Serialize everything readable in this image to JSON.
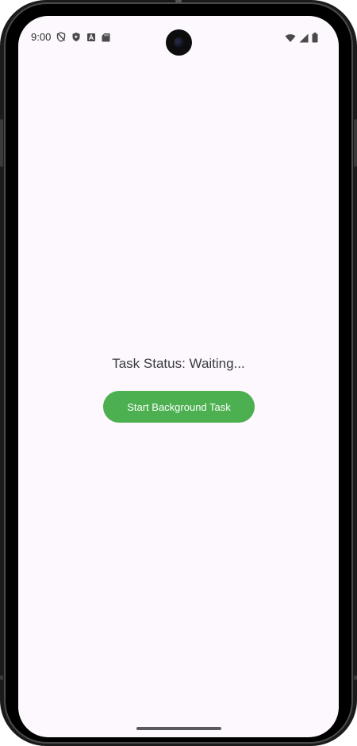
{
  "status_bar": {
    "time": "9:00",
    "left_icons": [
      "shield-off-icon",
      "play-protect-icon",
      "font-a-icon",
      "sd-card-icon"
    ],
    "right_icons": [
      "wifi-icon",
      "cell-signal-icon",
      "battery-icon"
    ]
  },
  "main": {
    "task_status": "Task Status: Waiting...",
    "start_button_label": "Start Background Task",
    "button_color": "#4caf50",
    "background_color": "#fdf7fe"
  }
}
